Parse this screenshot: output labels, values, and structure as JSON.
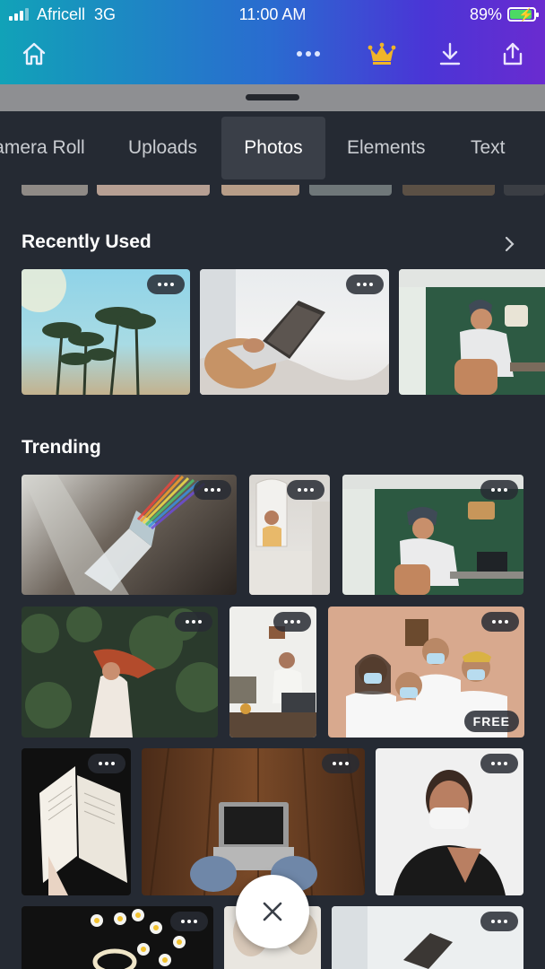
{
  "status_bar": {
    "carrier": "Africell",
    "network": "3G",
    "time": "11:00 AM",
    "battery_percent": "89%",
    "battery_level": 0.89
  },
  "toolbar": {
    "icons": [
      "home-icon",
      "more-icon",
      "crown-icon",
      "download-icon",
      "share-icon"
    ]
  },
  "tabs": [
    {
      "label": "Camera Roll",
      "active": false
    },
    {
      "label": "Uploads",
      "active": false
    },
    {
      "label": "Photos",
      "active": true
    },
    {
      "label": "Elements",
      "active": false
    },
    {
      "label": "Text",
      "active": false
    }
  ],
  "sections": {
    "recently_used": {
      "title": "Recently Used"
    },
    "trending": {
      "title": "Trending"
    }
  },
  "badges": {
    "free": "FREE"
  },
  "colors": {
    "accent_gradient_start": "#11a2b8",
    "accent_gradient_end": "#6a2bd0",
    "crown": "#f0b429",
    "panel_bg": "#252a33"
  }
}
